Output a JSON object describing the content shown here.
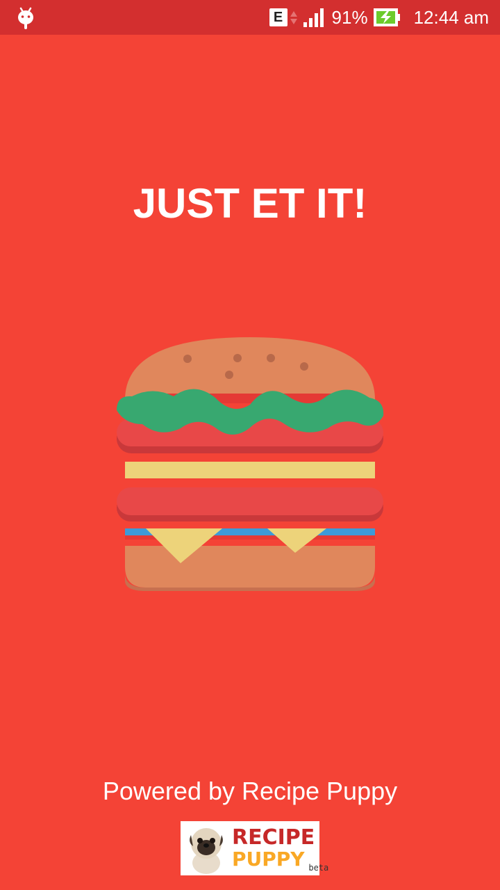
{
  "status_bar": {
    "network_type": "E",
    "battery_percent": "91%",
    "time": "12:44 am",
    "icons": [
      "android-debug-icon",
      "network-type-icon",
      "data-arrows-icon",
      "signal-icon",
      "battery-charging-icon"
    ]
  },
  "splash": {
    "title": "JUST ET IT!",
    "illustration": "burger-illustration",
    "powered_by": "Powered by Recipe Puppy"
  },
  "logo": {
    "line1": "RECIPE",
    "line2": "PUPPY",
    "badge": "beta"
  },
  "colors": {
    "background": "#f44336",
    "status_bar": "#d32f2f",
    "text": "#ffffff"
  }
}
